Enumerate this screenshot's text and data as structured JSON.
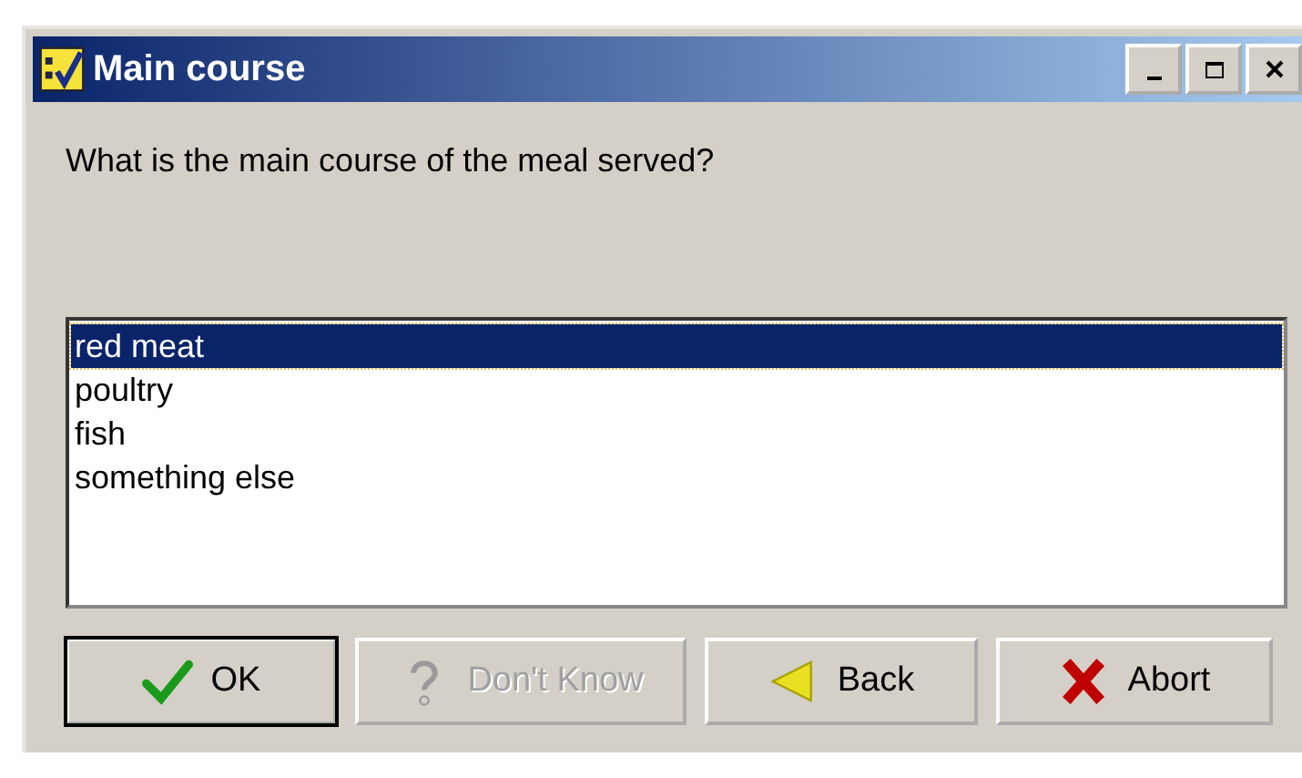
{
  "window": {
    "title": "Main course"
  },
  "question": "What is the main course of the meal served?",
  "options": [
    {
      "label": "red meat",
      "selected": true
    },
    {
      "label": "poultry",
      "selected": false
    },
    {
      "label": "fish",
      "selected": false
    },
    {
      "label": "something else",
      "selected": false
    }
  ],
  "buttons": [
    {
      "label": "OK",
      "kind": "check",
      "disabled": false,
      "default": true
    },
    {
      "label": "Don't Know",
      "kind": "question",
      "disabled": true,
      "default": false
    },
    {
      "label": "Back",
      "kind": "back",
      "disabled": false,
      "default": false
    },
    {
      "label": "Abort",
      "kind": "abort",
      "disabled": false,
      "default": false
    }
  ]
}
